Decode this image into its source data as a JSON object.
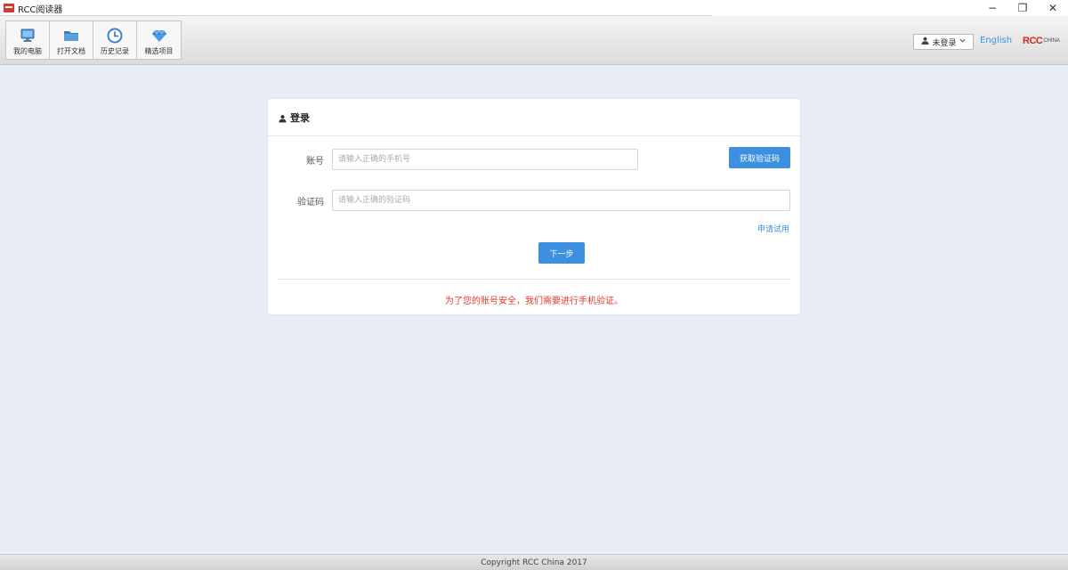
{
  "window": {
    "title": "RCC阅读器",
    "controls": {
      "minimize": "−",
      "restore": "❐",
      "close": "✕"
    }
  },
  "toolbar": {
    "items": [
      {
        "label": "我的电脑",
        "icon": "monitor-icon"
      },
      {
        "label": "打开文档",
        "icon": "folder-icon"
      },
      {
        "label": "历史记录",
        "icon": "clock-icon"
      },
      {
        "label": "精选项目",
        "icon": "diamond-icon"
      }
    ],
    "user_menu": {
      "label": "未登录",
      "icon": "user-icon"
    },
    "language_link": "English",
    "brand": {
      "rcc": "RCC",
      "china": "CHINA"
    }
  },
  "login": {
    "title": "登录",
    "account_label": "账号",
    "account_placeholder": "请输入正确的手机号",
    "get_code_button": "获取验证码",
    "code_label": "验证码",
    "code_placeholder": "请输入正确的验证码",
    "apply_trial_link": "申请试用",
    "next_button": "下一步",
    "notice": "为了您的账号安全，我们需要进行手机验证。"
  },
  "footer": {
    "copyright": "Copyright RCC China 2017"
  },
  "colors": {
    "accent": "#3d8fe0",
    "warning_text": "#e33b2f",
    "brand_red": "#d6261c"
  }
}
